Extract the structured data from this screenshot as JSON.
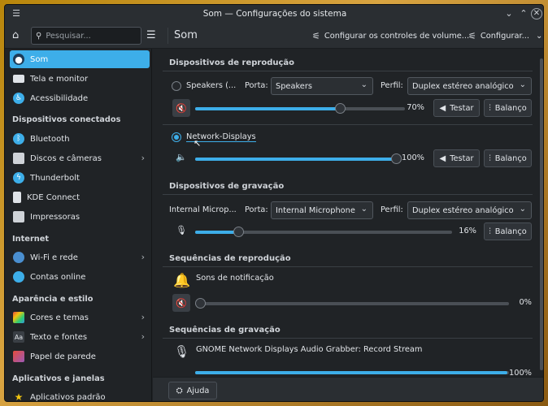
{
  "window": {
    "title": "Som — Configurações do sistema"
  },
  "header": {
    "search_placeholder": "Pesquisar...",
    "page_title": "Som",
    "configure_volume_label": "Configurar os controles de volume...",
    "configure_label": "Configurar..."
  },
  "sidebar": {
    "items_top": [
      {
        "label": "Som",
        "icon": "speaker-icon"
      },
      {
        "label": "Tela e monitor",
        "icon": "monitor-icon"
      },
      {
        "label": "Acessibilidade",
        "icon": "accessibility-icon"
      }
    ],
    "categories": [
      "Dispositivos conectados",
      "Internet",
      "Aparência e estilo",
      "Aplicativos e janelas"
    ],
    "devices": [
      {
        "label": "Bluetooth",
        "icon": "bluetooth-icon"
      },
      {
        "label": "Discos e câmeras",
        "icon": "disk-icon"
      },
      {
        "label": "Thunderbolt",
        "icon": "thunderbolt-icon"
      },
      {
        "label": "KDE Connect",
        "icon": "phone-icon"
      },
      {
        "label": "Impressoras",
        "icon": "printer-icon"
      }
    ],
    "internet": [
      {
        "label": "Wi-Fi e rede",
        "icon": "globe-icon"
      },
      {
        "label": "Contas online",
        "icon": "accounts-icon"
      }
    ],
    "appearance": [
      {
        "label": "Cores e temas",
        "icon": "palette-icon"
      },
      {
        "label": "Texto e fontes",
        "icon": "font-icon"
      },
      {
        "label": "Papel de parede",
        "icon": "wallpaper-icon"
      }
    ],
    "apps": [
      {
        "label": "Aplicativos padrão",
        "icon": "star-icon"
      }
    ]
  },
  "playback": {
    "title": "Dispositivos de reprodução",
    "port_label": "Porta:",
    "profile_label": "Perfil:",
    "test_label": "Testar",
    "balance_label": "Balanço",
    "devices": [
      {
        "name": "Speakers (...",
        "port": "Speakers",
        "profile": "Duplex estéreo analógico",
        "volume_text": "70%",
        "volume": 70,
        "muted": true,
        "selected": false
      },
      {
        "name": "Network-Displays",
        "volume_text": "100%",
        "volume": 100,
        "muted": false,
        "selected": true
      }
    ]
  },
  "recording": {
    "title": "Dispositivos de gravação",
    "device_name": "Internal Microp...",
    "port_label": "Porta:",
    "port": "Internal Microphone",
    "profile_label": "Perfil:",
    "profile": "Duplex estéreo analógico",
    "volume_text": "16%",
    "volume": 16,
    "balance_label": "Balanço"
  },
  "playback_streams": {
    "title": "Sequências de reprodução",
    "stream_name": "Sons de notificação",
    "volume_text": "0%",
    "volume": 0
  },
  "recording_streams": {
    "title": "Sequências de gravação",
    "stream_name": "GNOME Network Displays Audio Grabber: Record Stream",
    "volume_text": "100%",
    "volume": 100
  },
  "footer": {
    "help_label": "Ajuda"
  },
  "colors": {
    "accent": "#3daee9",
    "window_bg": "#202326",
    "header_bg": "#2a2e32"
  }
}
